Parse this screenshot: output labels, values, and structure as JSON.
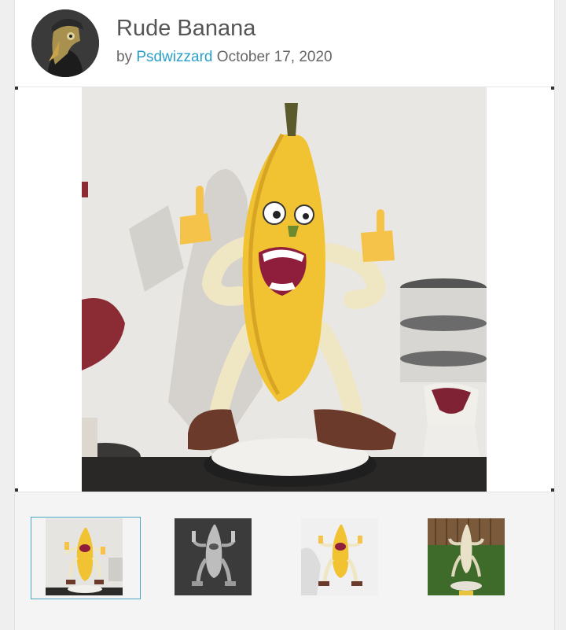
{
  "post": {
    "title": "Rude Banana",
    "by_prefix": "by",
    "author": "Psdwizzard",
    "date": "October 17, 2020"
  },
  "colors": {
    "link": "#2a9fc9",
    "banana": "#f1c232",
    "background": "#efefef"
  },
  "gallery": {
    "selected_index": 0,
    "thumbnails": [
      {
        "name": "thumb-photo-white-wall"
      },
      {
        "name": "thumb-render-gray"
      },
      {
        "name": "thumb-render-color"
      },
      {
        "name": "thumb-photo-grass"
      }
    ]
  }
}
